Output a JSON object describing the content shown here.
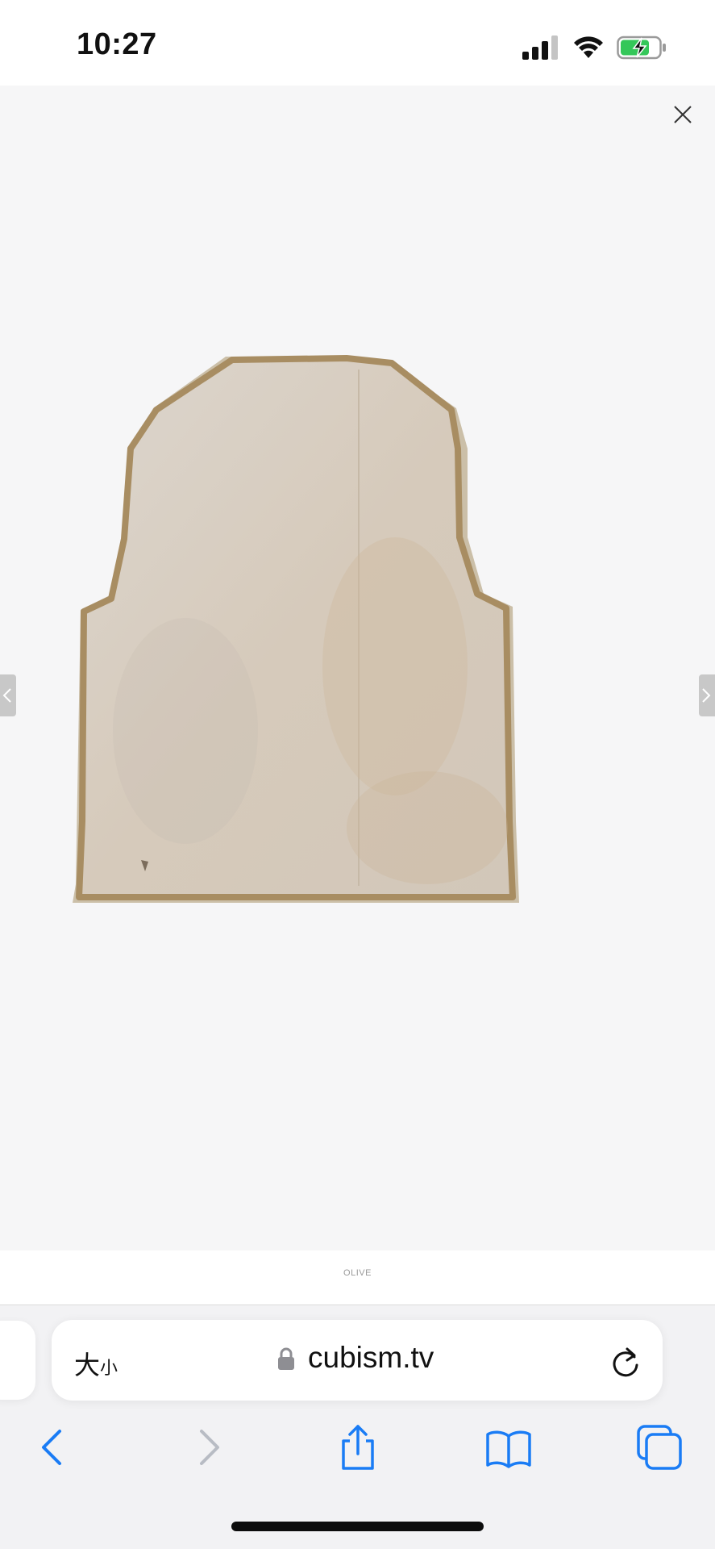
{
  "status_bar": {
    "time": "10:27",
    "icons": [
      "cellular-signal-icon",
      "wifi-icon",
      "battery-charging-icon"
    ],
    "battery_color": "#34c759"
  },
  "viewer": {
    "caption": "OLIVE",
    "image": "vest-product-photo",
    "controls": [
      "close-icon",
      "previous-image-arrow",
      "next-image-arrow"
    ]
  },
  "address_bar": {
    "text_size_label_large": "大",
    "text_size_label_small": "小",
    "domain": "cubism.tv",
    "icons": [
      "lock-icon",
      "reload-icon"
    ]
  },
  "toolbar": {
    "buttons": [
      "back-button",
      "forward-button",
      "share-button",
      "bookmarks-button",
      "tabs-button"
    ],
    "accent_color": "#1a7cf5",
    "disabled_color": "#b8bcc4"
  }
}
